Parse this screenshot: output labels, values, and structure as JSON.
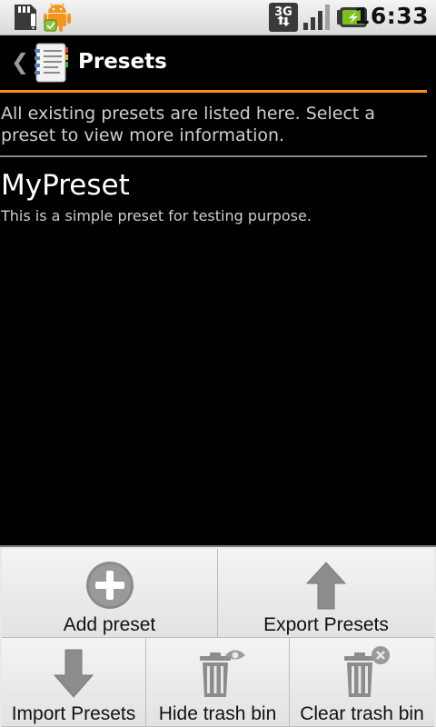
{
  "status_bar": {
    "time": "16:33",
    "network_label": "3G",
    "icons": [
      "sd-card-icon",
      "android-market-icon",
      "3g-data-icon",
      "signal-strength-icon",
      "battery-charging-icon"
    ]
  },
  "title_bar": {
    "back_icon": "chevron-left-icon",
    "app_icon": "notebook-icon",
    "title": "Presets"
  },
  "intro_text": "All existing presets are listed here. Select a preset to view more information.",
  "presets": [
    {
      "name": "MyPreset",
      "description": "This is a simple preset for testing purpose."
    }
  ],
  "menu": {
    "items": [
      {
        "label": "Add preset",
        "icon": "plus-circle-icon"
      },
      {
        "label": "Export Presets",
        "icon": "arrow-up-icon"
      },
      {
        "label": "Import Presets",
        "icon": "arrow-down-icon"
      },
      {
        "label": "Hide trash bin",
        "icon": "trash-eye-icon"
      },
      {
        "label": "Clear trash bin",
        "icon": "trash-clear-icon"
      }
    ]
  },
  "colors": {
    "accent": "#f7931e",
    "background": "#000000",
    "menu_background": "#e9e9e9"
  }
}
